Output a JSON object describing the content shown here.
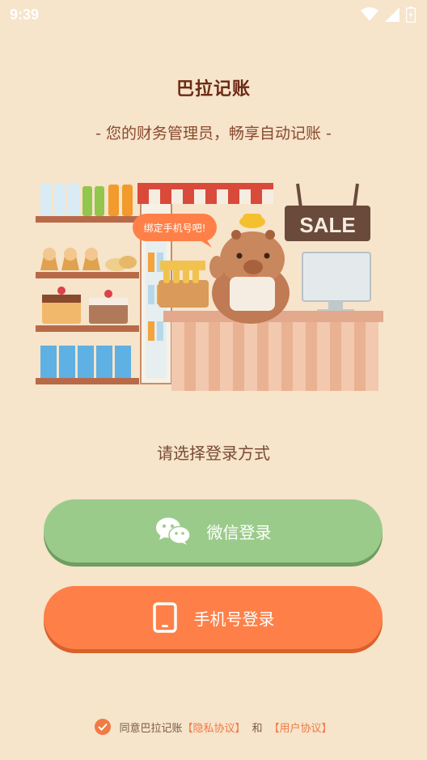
{
  "status_bar": {
    "time": "9:39"
  },
  "header": {
    "title": "巴拉记账",
    "subtitle": "- 您的财务管理员，畅享自动记账 -"
  },
  "illustration": {
    "speech_bubble": "绑定手机号吧!",
    "sign": "SALE"
  },
  "login": {
    "prompt": "请选择登录方式",
    "wechat_label": "微信登录",
    "phone_label": "手机号登录"
  },
  "agreement": {
    "prefix": "同意巴拉记账",
    "privacy_link": "【隐私协议】",
    "and": "和",
    "user_link": "【用户协议】"
  },
  "colors": {
    "background": "#f6e4cb",
    "wechat_button": "#9bcb8b",
    "phone_button": "#fe8048",
    "accent": "#f07a44"
  },
  "icons": [
    "wifi-icon",
    "signal-icon",
    "battery-icon",
    "wechat-icon",
    "phone-icon",
    "check-icon"
  ]
}
